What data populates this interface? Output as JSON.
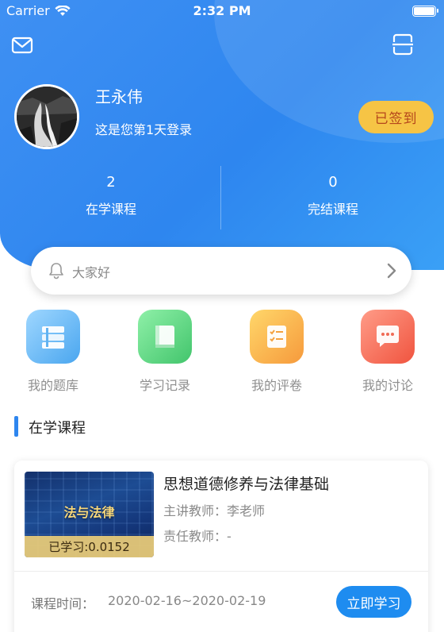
{
  "status_bar": {
    "carrier": "Carrier",
    "time": "2:32 PM"
  },
  "profile": {
    "name": "王永伟",
    "login_text": "这是您第1天登录",
    "signin_label": "已签到"
  },
  "stats": [
    {
      "value": "2",
      "label": "在学课程"
    },
    {
      "value": "0",
      "label": "完结课程"
    }
  ],
  "notice": {
    "text": "大家好"
  },
  "quick_actions": [
    {
      "label": "我的题库",
      "icon": "question-bank-icon"
    },
    {
      "label": "学习记录",
      "icon": "study-record-icon"
    },
    {
      "label": "我的评卷",
      "icon": "grading-icon"
    },
    {
      "label": "我的讨论",
      "icon": "discussion-icon"
    }
  ],
  "section": {
    "title": "在学课程"
  },
  "course": {
    "thumb_title": "法与法律",
    "progress": "已学习:0.0152",
    "name": "思想道德修养与法律基础",
    "lead_teacher": "主讲教师：李老师",
    "resp_teacher": "责任教师：-",
    "time_label": "课程时间：",
    "time_value": "2020-02-16~2020-02-19",
    "study_label": "立即学习"
  },
  "colors": {
    "header_blue": "#2e86ef",
    "signin_yellow": "#f6c445",
    "study_button_blue": "#1e8cf0"
  }
}
